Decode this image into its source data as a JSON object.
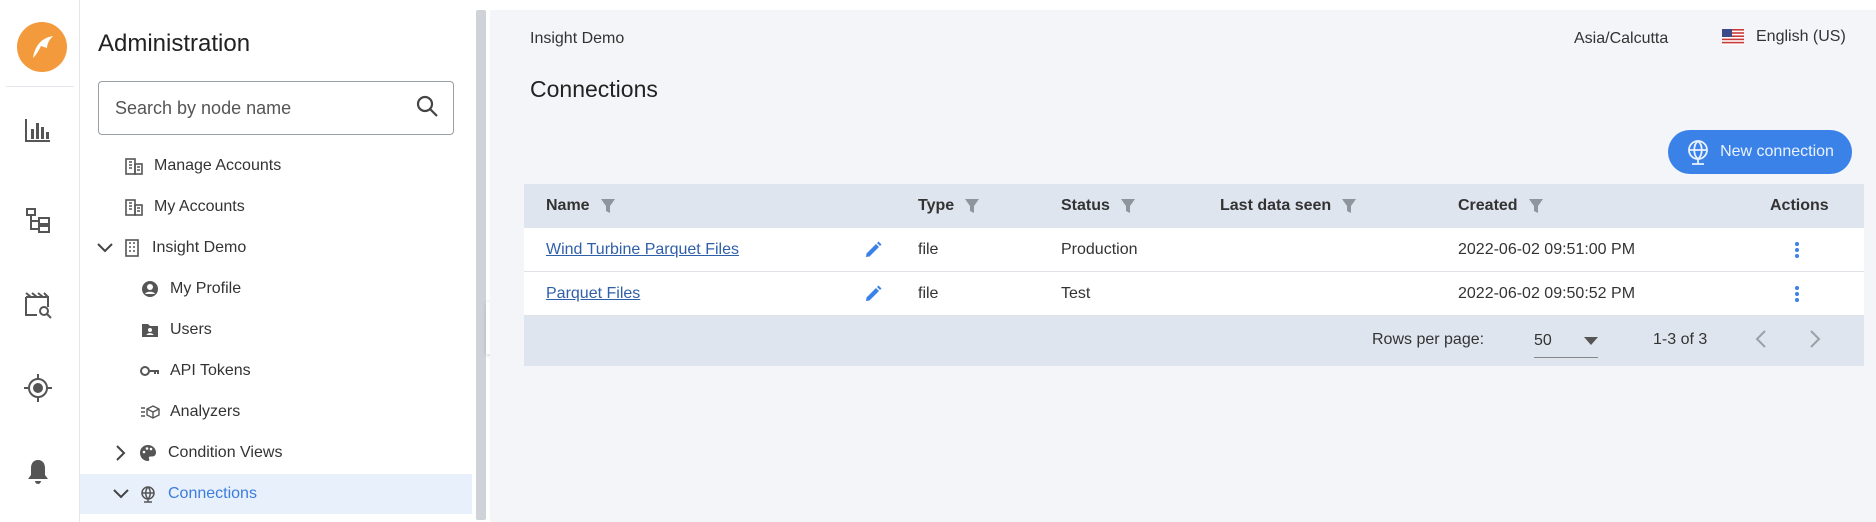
{
  "sidebar_title": "Administration",
  "search": {
    "placeholder": "Search by node name"
  },
  "tree": [
    {
      "label": "Manage Accounts"
    },
    {
      "label": "My Accounts"
    },
    {
      "label": "Insight Demo"
    },
    {
      "label": "My Profile"
    },
    {
      "label": "Users"
    },
    {
      "label": "API Tokens"
    },
    {
      "label": "Analyzers"
    },
    {
      "label": "Condition Views"
    },
    {
      "label": "Connections"
    }
  ],
  "header": {
    "org": "Insight Demo",
    "timezone": "Asia/Calcutta",
    "language": "English (US)"
  },
  "page_title": "Connections",
  "new_button": "New connection",
  "table": {
    "columns": [
      "Name",
      "Type",
      "Status",
      "Last data seen",
      "Created",
      "Actions"
    ],
    "rows": [
      {
        "name": "Wind Turbine Parquet Files",
        "type": "file",
        "status": "Production",
        "last_seen": "",
        "created": "2022-06-02 09:51:00 PM"
      },
      {
        "name": "Parquet Files",
        "type": "file",
        "status": "Test",
        "last_seen": "",
        "created": "2022-06-02 09:50:52 PM"
      }
    ]
  },
  "pagination": {
    "rows_label": "Rows per page:",
    "rows_value": "50",
    "range": "1-3 of 3"
  },
  "colors": {
    "accent": "#3b82e8",
    "logo": "#f39a3c",
    "header_bg": "#dfe5ee",
    "link": "#2f5fa8"
  }
}
